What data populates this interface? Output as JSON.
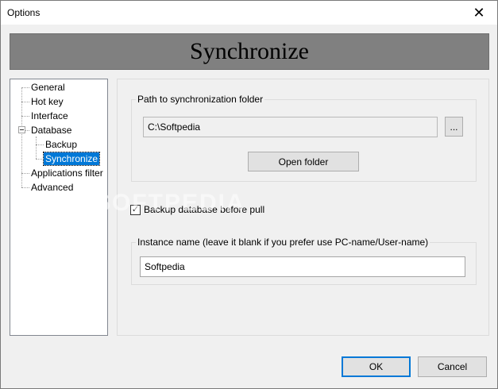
{
  "window": {
    "title": "Options",
    "close_icon": "close-icon"
  },
  "banner": {
    "title": "Synchronize"
  },
  "tree": {
    "items": [
      {
        "label": "General"
      },
      {
        "label": "Hot key"
      },
      {
        "label": "Interface"
      },
      {
        "label": "Database"
      },
      {
        "label": "Backup"
      },
      {
        "label": "Synchronize",
        "selected": true
      },
      {
        "label": "Applications filter"
      },
      {
        "label": "Advanced"
      }
    ]
  },
  "sync": {
    "path_group_label": "Path to synchronization folder",
    "path_value": "C:\\Softpedia",
    "browse_label": "...",
    "open_folder_label": "Open folder",
    "backup_checkbox_label": "Backup database before pull",
    "backup_checked": true,
    "check_mark": "✓",
    "instance_group_label": "Instance name (leave it blank if you prefer use PC-name/User-name)",
    "instance_value": "Softpedia"
  },
  "footer": {
    "ok_label": "OK",
    "cancel_label": "Cancel"
  },
  "watermark": "SOFTPEDIA",
  "colors": {
    "selection": "#0078d7",
    "banner": "#808080",
    "window": "#f0f0f0"
  }
}
